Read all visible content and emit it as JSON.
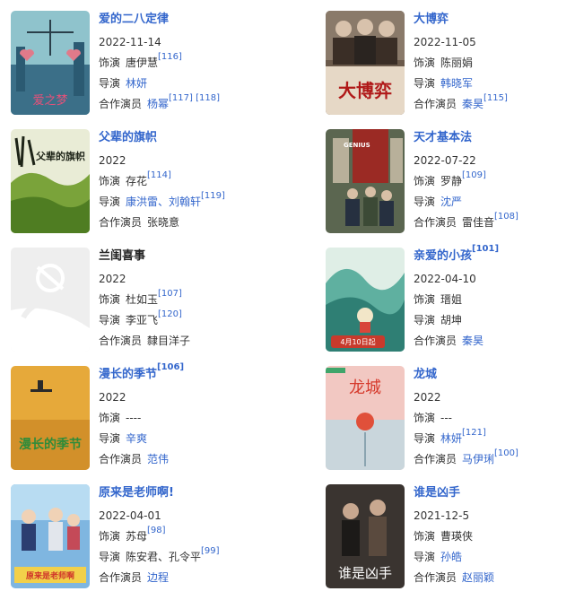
{
  "labels": {
    "cast": "饰演",
    "director": "导演",
    "costar": "合作演员"
  },
  "works": [
    {
      "title": "爱的二八定律",
      "date": "2022-11-14",
      "role": "唐伊慧",
      "role_ref": "[116]",
      "director": "林妍",
      "director_ref": "",
      "costar": "杨幂",
      "costar_ref": "[117] [118]",
      "poster_text": "爱之梦",
      "poster_theme": "#8fc3cc",
      "title_linked": true,
      "director_linked": true,
      "costar_linked": true
    },
    {
      "title": "大博弈",
      "date": "2022-11-05",
      "role": "陈丽娟",
      "role_ref": "",
      "director": "韩晓军",
      "director_ref": "",
      "costar": "秦昊",
      "costar_ref": "[115]",
      "poster_text": "大博弈",
      "poster_theme": "#6b5a4b",
      "title_linked": true,
      "director_linked": true,
      "costar_linked": true
    },
    {
      "title": "父辈的旗帜",
      "date": "2022",
      "role": "存花",
      "role_ref": "[114]",
      "director": "康洪雷、刘翰轩",
      "director_ref": "[119]",
      "costar": "张晓意",
      "costar_ref": "",
      "poster_text": "父辈的旗帜",
      "poster_theme": "#7aa33a",
      "title_linked": true,
      "director_linked": true,
      "costar_linked": false
    },
    {
      "title": "天才基本法",
      "date": "2022-07-22",
      "role": "罗静",
      "role_ref": "[109]",
      "director": "沈严",
      "director_ref": "",
      "costar": "雷佳音",
      "costar_ref": "[108]",
      "poster_text": "GENIUS",
      "poster_theme": "#5b6650",
      "title_linked": true,
      "director_linked": true,
      "costar_linked": false
    },
    {
      "title": "兰闺喜事",
      "date": "2022",
      "role": "杜如玉",
      "role_ref": "[107]",
      "director": "李亚飞",
      "director_ref": "[120]",
      "costar": "隸目洋子",
      "costar_ref": "",
      "poster_text": "",
      "poster_theme": "#eeeeee",
      "title_linked": false,
      "director_linked": false,
      "costar_linked": false
    },
    {
      "title": "亲爱的小孩",
      "title_ref": "[101]",
      "date": "2022-04-10",
      "role": "瑨姐",
      "role_ref": "",
      "director": "胡坤",
      "director_ref": "",
      "costar": "秦昊",
      "costar_ref": "",
      "poster_text": "4月10日起",
      "poster_theme": "#5fb0a0",
      "title_linked": true,
      "director_linked": false,
      "costar_linked": true
    },
    {
      "title": "漫长的季节",
      "title_ref": "[106]",
      "date": "2022",
      "role": "----",
      "role_ref": "",
      "director": "辛爽",
      "director_ref": "",
      "costar": "范伟",
      "costar_ref": "",
      "poster_text": "漫长的季节",
      "poster_theme": "#e6a93a",
      "title_linked": true,
      "director_linked": true,
      "costar_linked": true
    },
    {
      "title": "龙城",
      "date": "2022",
      "role": "---",
      "role_ref": "",
      "director": "林妍",
      "director_ref": "[121]",
      "costar": "马伊琍",
      "costar_ref": "[100]",
      "poster_text": "龙城",
      "poster_theme": "#f2c8c2",
      "title_linked": true,
      "director_linked": true,
      "costar_linked": true
    },
    {
      "title": "原来是老师啊!",
      "date": "2022-04-01",
      "role": "苏母",
      "role_ref": "[98]",
      "director": "陈安君、孔令平",
      "director_ref": "[99]",
      "costar": "边程",
      "costar_ref": "",
      "poster_text": "原来是老师啊",
      "poster_theme": "#7fb6e0",
      "title_linked": true,
      "director_linked": false,
      "costar_linked": true
    },
    {
      "title": "谁是凶手",
      "date": "2021-12-5",
      "role": "曹瑛侠",
      "role_ref": "",
      "director": "孙皓",
      "director_ref": "",
      "costar": "赵丽颖",
      "costar_ref": "",
      "poster_text": "谁是凶手",
      "poster_theme": "#3a3430",
      "title_linked": true,
      "director_linked": true,
      "costar_linked": true
    }
  ]
}
